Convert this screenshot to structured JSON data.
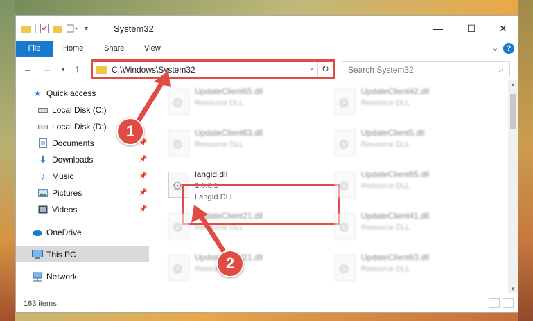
{
  "window": {
    "title": "System32",
    "controls": {
      "minimize": "—",
      "maximize": "☐",
      "close": "✕"
    }
  },
  "ribbon": {
    "tabs": [
      "File",
      "Home",
      "Share",
      "View"
    ],
    "help": "?"
  },
  "address_bar": {
    "path": "C:\\Windows\\System32",
    "refresh_icon": "refresh-icon"
  },
  "search": {
    "placeholder": "Search System32"
  },
  "sidebar": {
    "items": [
      {
        "label": "Quick access",
        "icon": "star-icon",
        "pinned": false
      },
      {
        "label": "Local Disk (C:)",
        "icon": "drive-icon",
        "pinned": false
      },
      {
        "label": "Local Disk (D:)",
        "icon": "drive-icon",
        "pinned": false
      },
      {
        "label": "Documents",
        "icon": "documents-icon",
        "pinned": true
      },
      {
        "label": "Downloads",
        "icon": "downloads-icon",
        "pinned": true
      },
      {
        "label": "Music",
        "icon": "music-icon",
        "pinned": true
      },
      {
        "label": "Pictures",
        "icon": "pictures-icon",
        "pinned": true
      },
      {
        "label": "Videos",
        "icon": "videos-icon",
        "pinned": true
      },
      {
        "label": "OneDrive",
        "icon": "cloud-icon",
        "pinned": false
      },
      {
        "label": "This PC",
        "icon": "pc-icon",
        "pinned": false,
        "selected": true
      },
      {
        "label": "Network",
        "icon": "network-icon",
        "pinned": false
      }
    ]
  },
  "files": {
    "highlighted": {
      "name": "langid.dll",
      "version": "1.0.0.1",
      "description": "LangId DLL"
    },
    "blurred": [
      {
        "name": "UpdateClient65.dll",
        "description": "Resource DLL"
      },
      {
        "name": "UpdateClient42.dll",
        "description": "Resource DLL"
      },
      {
        "name": "UpdateClient63.dll",
        "description": "Resource DLL"
      },
      {
        "name": "UpdateClient5.dll",
        "description": "Resource DLL"
      },
      {
        "name": "UpdateClient65.dll",
        "description": "Resource DLL"
      },
      {
        "name": "UpdateClient21.dll",
        "description": "Resource DLL"
      },
      {
        "name": "UpdateClient41.dll",
        "description": "Resource DLL"
      },
      {
        "name": "UpdateClient21.dll",
        "description": "Resource DLL"
      },
      {
        "name": "UpdateClient63.dll",
        "description": "Resource DLL"
      }
    ]
  },
  "status": {
    "item_count": "163 items"
  },
  "annotations": {
    "step1": "1",
    "step2": "2",
    "color": "#e04b43"
  }
}
